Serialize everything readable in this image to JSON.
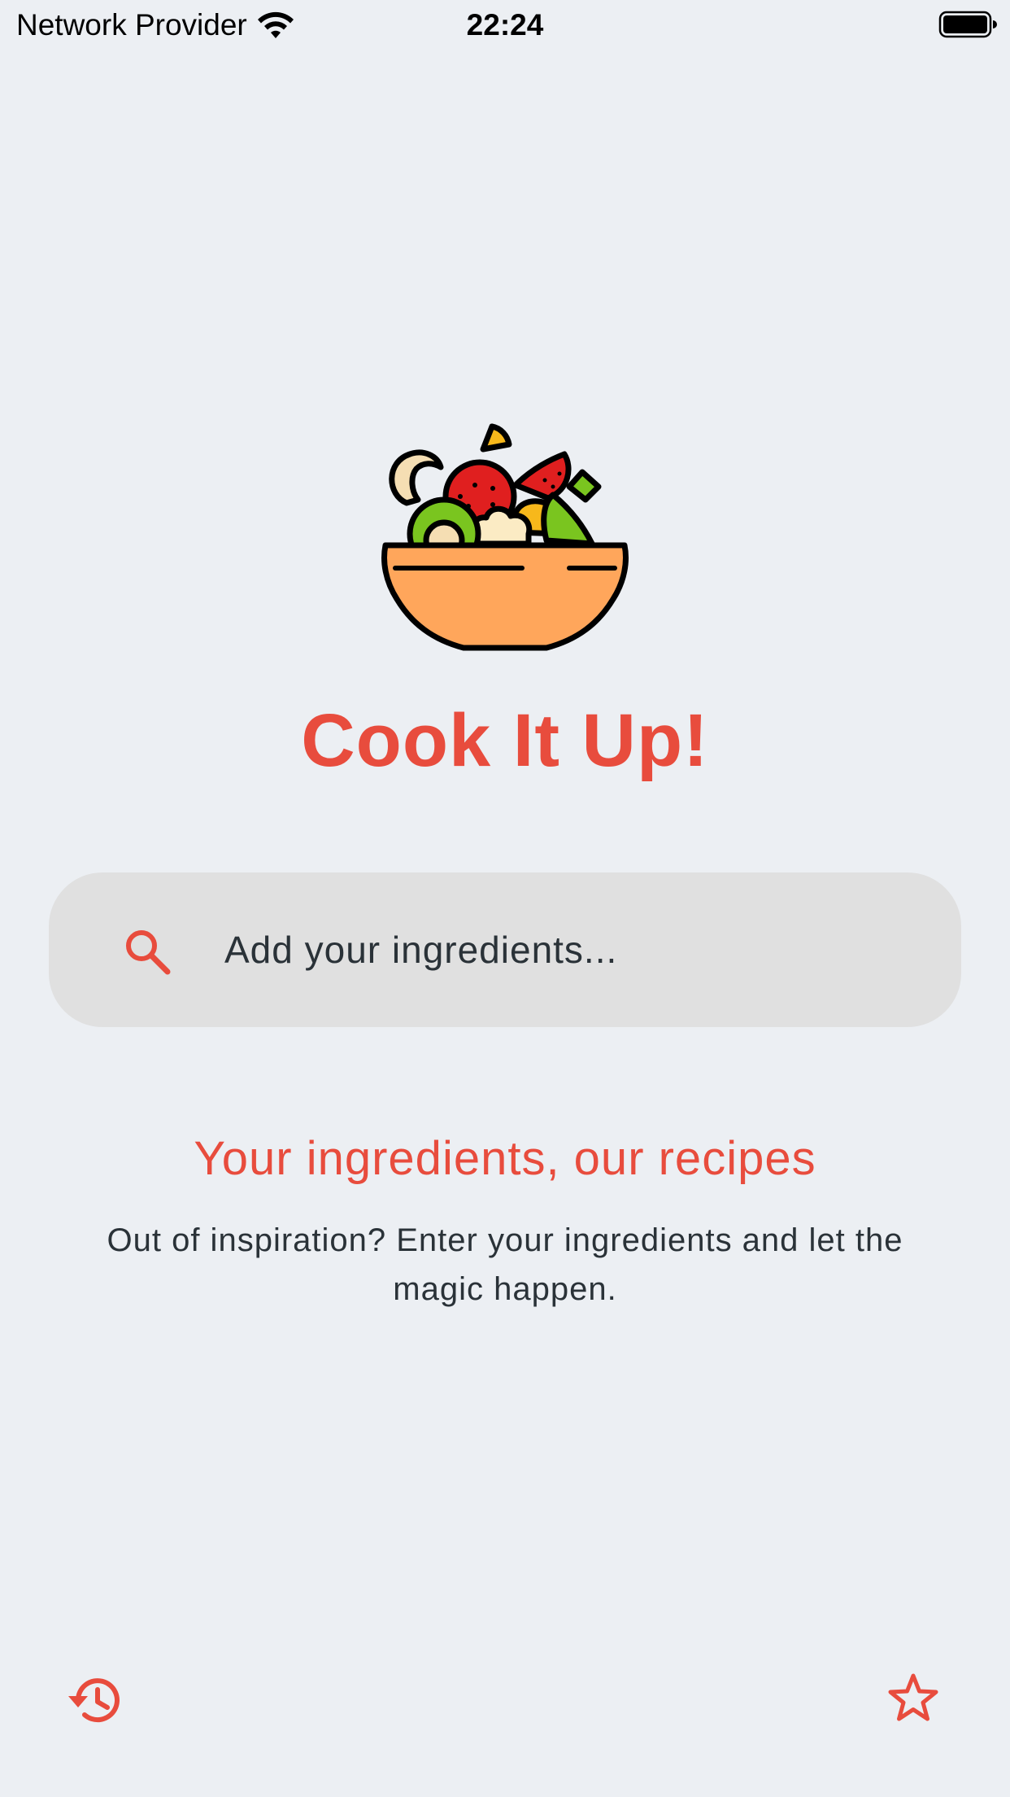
{
  "status_bar": {
    "carrier": "Network Provider",
    "time": "22:24",
    "wifi_icon": "wifi-icon",
    "battery_icon": "battery-full-icon"
  },
  "app": {
    "title": "Cook It Up!",
    "logo_icon": "salad-bowl-icon"
  },
  "search": {
    "placeholder": "Add your ingredients...",
    "value": "",
    "icon": "search-icon"
  },
  "intro": {
    "tagline": "Your ingredients, our recipes",
    "description": "Out of inspiration? Enter your ingredients and let the magic happen."
  },
  "bottom_bar": {
    "history_icon": "history-icon",
    "favorites_icon": "star-icon"
  },
  "colors": {
    "accent": "#E84C3D",
    "background": "#ECEFF3",
    "search_background": "#E0E0E0",
    "text_dark": "#2A3238"
  }
}
